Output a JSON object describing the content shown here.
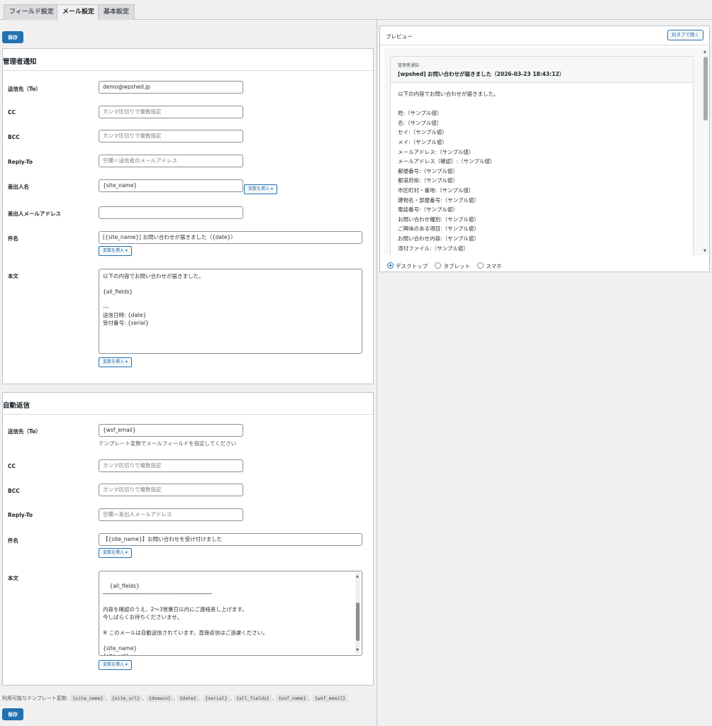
{
  "tabs": [
    {
      "label": "フィールド設定",
      "active": false
    },
    {
      "label": "メール設定",
      "active": true
    },
    {
      "label": "基本設定",
      "active": false
    }
  ],
  "save_label": "保存",
  "insert_var_label": "変数を挿入 ▾",
  "admin": {
    "title": "管理者通知",
    "to_label": "送信先（To）",
    "to_value": "demo@wpshed.jp",
    "cc_label": "CC",
    "cc_placeholder": "カンマ区切りで複数指定",
    "bcc_label": "BCC",
    "bcc_placeholder": "カンマ区切りで複数指定",
    "replyto_label": "Reply-To",
    "replyto_placeholder": "空欄＝送信者のメールアドレス",
    "from_name_label": "差出人名",
    "from_name_value": "{site_name}",
    "from_email_label": "差出人メールアドレス",
    "from_email_value": "",
    "subject_label": "件名",
    "subject_value": "[{site_name}] お問い合わせが届きました（{date}）",
    "body_label": "本文",
    "body_value": "以下の内容でお問い合わせが届きました。\n\n{all_fields}\n\n---\n送信日時: {date}\n受付番号: {serial}"
  },
  "auto": {
    "title": "自動返信",
    "to_label": "送信先（To）",
    "to_value": "{wsf_email}",
    "to_hint": "テンプレート変数でメールフィールドを指定してください",
    "cc_label": "CC",
    "cc_placeholder": "カンマ区切りで複数指定",
    "bcc_label": "BCC",
    "bcc_placeholder": "カンマ区切りで複数指定",
    "replyto_label": "Reply-To",
    "replyto_placeholder": "空欄＝差出人メールアドレス",
    "subject_label": "件名",
    "subject_value": "【{site_name}】お問い合わせを受け付けました",
    "body_label": "本文",
    "body_value": "{all_fields}\n──────────────────────────────────\n\n内容を確認のうえ、2〜3営業日以内にご連絡差し上げます。\n今しばらくお待ちくださいませ。\n\n※ このメールは自動送信されています。直接返信はご遠慮ください。\n\n{site_name}\n{site_url}"
  },
  "vars": {
    "label": "利用可能なテンプレート変数:",
    "items": [
      "{site_name}",
      "{site_url}",
      "{domain}",
      "{date}",
      "{serial}",
      "{all_fields}",
      "{wsf_name}",
      "{wsf_email}"
    ]
  },
  "preview": {
    "title": "プレビュー",
    "open_tab": "別タブで開く",
    "mail_kind": "管理者通知",
    "mail_subject": "[wpshed] お問い合わせが届きました（2026-03-23 18:43:12）",
    "mail_intro": "以下の内容でお問い合わせが届きました。",
    "mail_lines": [
      "姓:（サンプル値）",
      "名:（サンプル値）",
      "セイ:（サンプル値）",
      "メイ:（サンプル値）",
      "メールアドレス:（サンプル値）",
      "メールアドレス（確認）:（サンプル値）",
      "郵便番号:（サンプル値）",
      "都道府県:（サンプル値）",
      "市区町村・番地:（サンプル値）",
      "建物名・部屋番号:（サンプル値）",
      "電話番号:（サンプル値）",
      "お問い合わせ種別:（サンプル値）",
      "ご興味のある項目:（サンプル値）",
      "お問い合わせ内容:（サンプル値）",
      "添付ファイル:（サンプル値）"
    ],
    "devices": [
      {
        "label": "デスクトップ",
        "selected": true
      },
      {
        "label": "タブレット",
        "selected": false
      },
      {
        "label": "スマホ",
        "selected": false
      }
    ]
  }
}
